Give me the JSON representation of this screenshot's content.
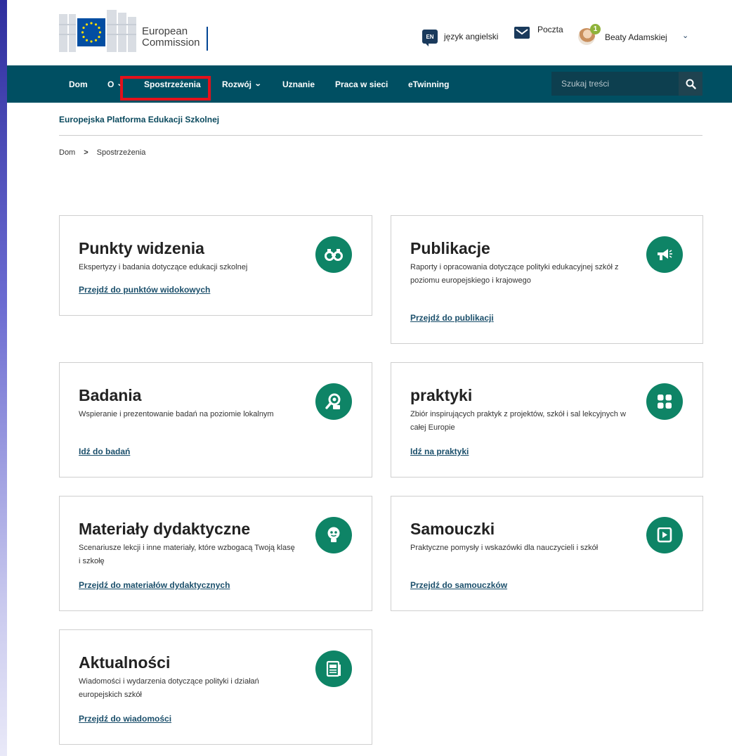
{
  "header": {
    "logo_line1": "European",
    "logo_line2": "Commission",
    "lang_code": "EN",
    "lang_label": "język angielski",
    "mail_label": "Poczta",
    "user_badge": "1",
    "user_name": "Beaty Adamskiej"
  },
  "nav": {
    "items": [
      {
        "label": "Dom"
      },
      {
        "label": "O"
      },
      {
        "label": "Spostrzeżenia"
      },
      {
        "label": "Rozwój"
      },
      {
        "label": "Uznanie"
      },
      {
        "label": "Praca w sieci"
      },
      {
        "label": "eTwinning"
      }
    ],
    "search_placeholder": "Szukaj treści"
  },
  "platform_title": "Europejska Platforma Edukacji Szkolnej",
  "breadcrumb": {
    "home": "Dom",
    "sep": ">",
    "current": "Spostrzeżenia"
  },
  "colors": {
    "nav": "#004f62",
    "accent_icon": "#0e8466",
    "highlight": "#e4111b"
  },
  "cards": [
    {
      "title": "Punkty widzenia",
      "desc": "Ekspertyzy i badania dotyczące edukacji szkolnej",
      "link": "Przejdź do punktów widokowych",
      "icon": "binoculars-icon"
    },
    {
      "title": "Publikacje",
      "desc": "Raporty i opracowania dotyczące polityki edukacyjnej szkół z poziomu europejskiego i krajowego",
      "link": "Przejdź do publikacji",
      "icon": "megaphone-icon"
    },
    {
      "title": "Badania",
      "desc": "Wspieranie i prezentowanie badań na poziomie lokalnym",
      "link": "Idź do badań",
      "icon": "research-icon"
    },
    {
      "title": "praktyki",
      "desc": "Zbiór inspirujących praktyk z projektów, szkół i sal lekcyjnych w całej Europie",
      "link": "Idź na praktyki",
      "icon": "grid-icon"
    },
    {
      "title": "Materiały dydaktyczne",
      "desc": "Scenariusze lekcji i inne materiały, które wzbogacą Twoją klasę i szkołę",
      "link": "Przejdź do materiałów dydaktycznych",
      "icon": "lightbulb-icon"
    },
    {
      "title": "Samouczki",
      "desc": "Praktyczne pomysły i wskazówki dla nauczycieli i szkół",
      "link": "Przejdź do samouczków",
      "icon": "video-tutorial-icon"
    },
    {
      "title": "Aktualności",
      "desc": "Wiadomości i wydarzenia dotyczące polityki i działań europejskich szkół",
      "link": "Przejdź do wiadomości",
      "icon": "newspaper-icon"
    }
  ]
}
